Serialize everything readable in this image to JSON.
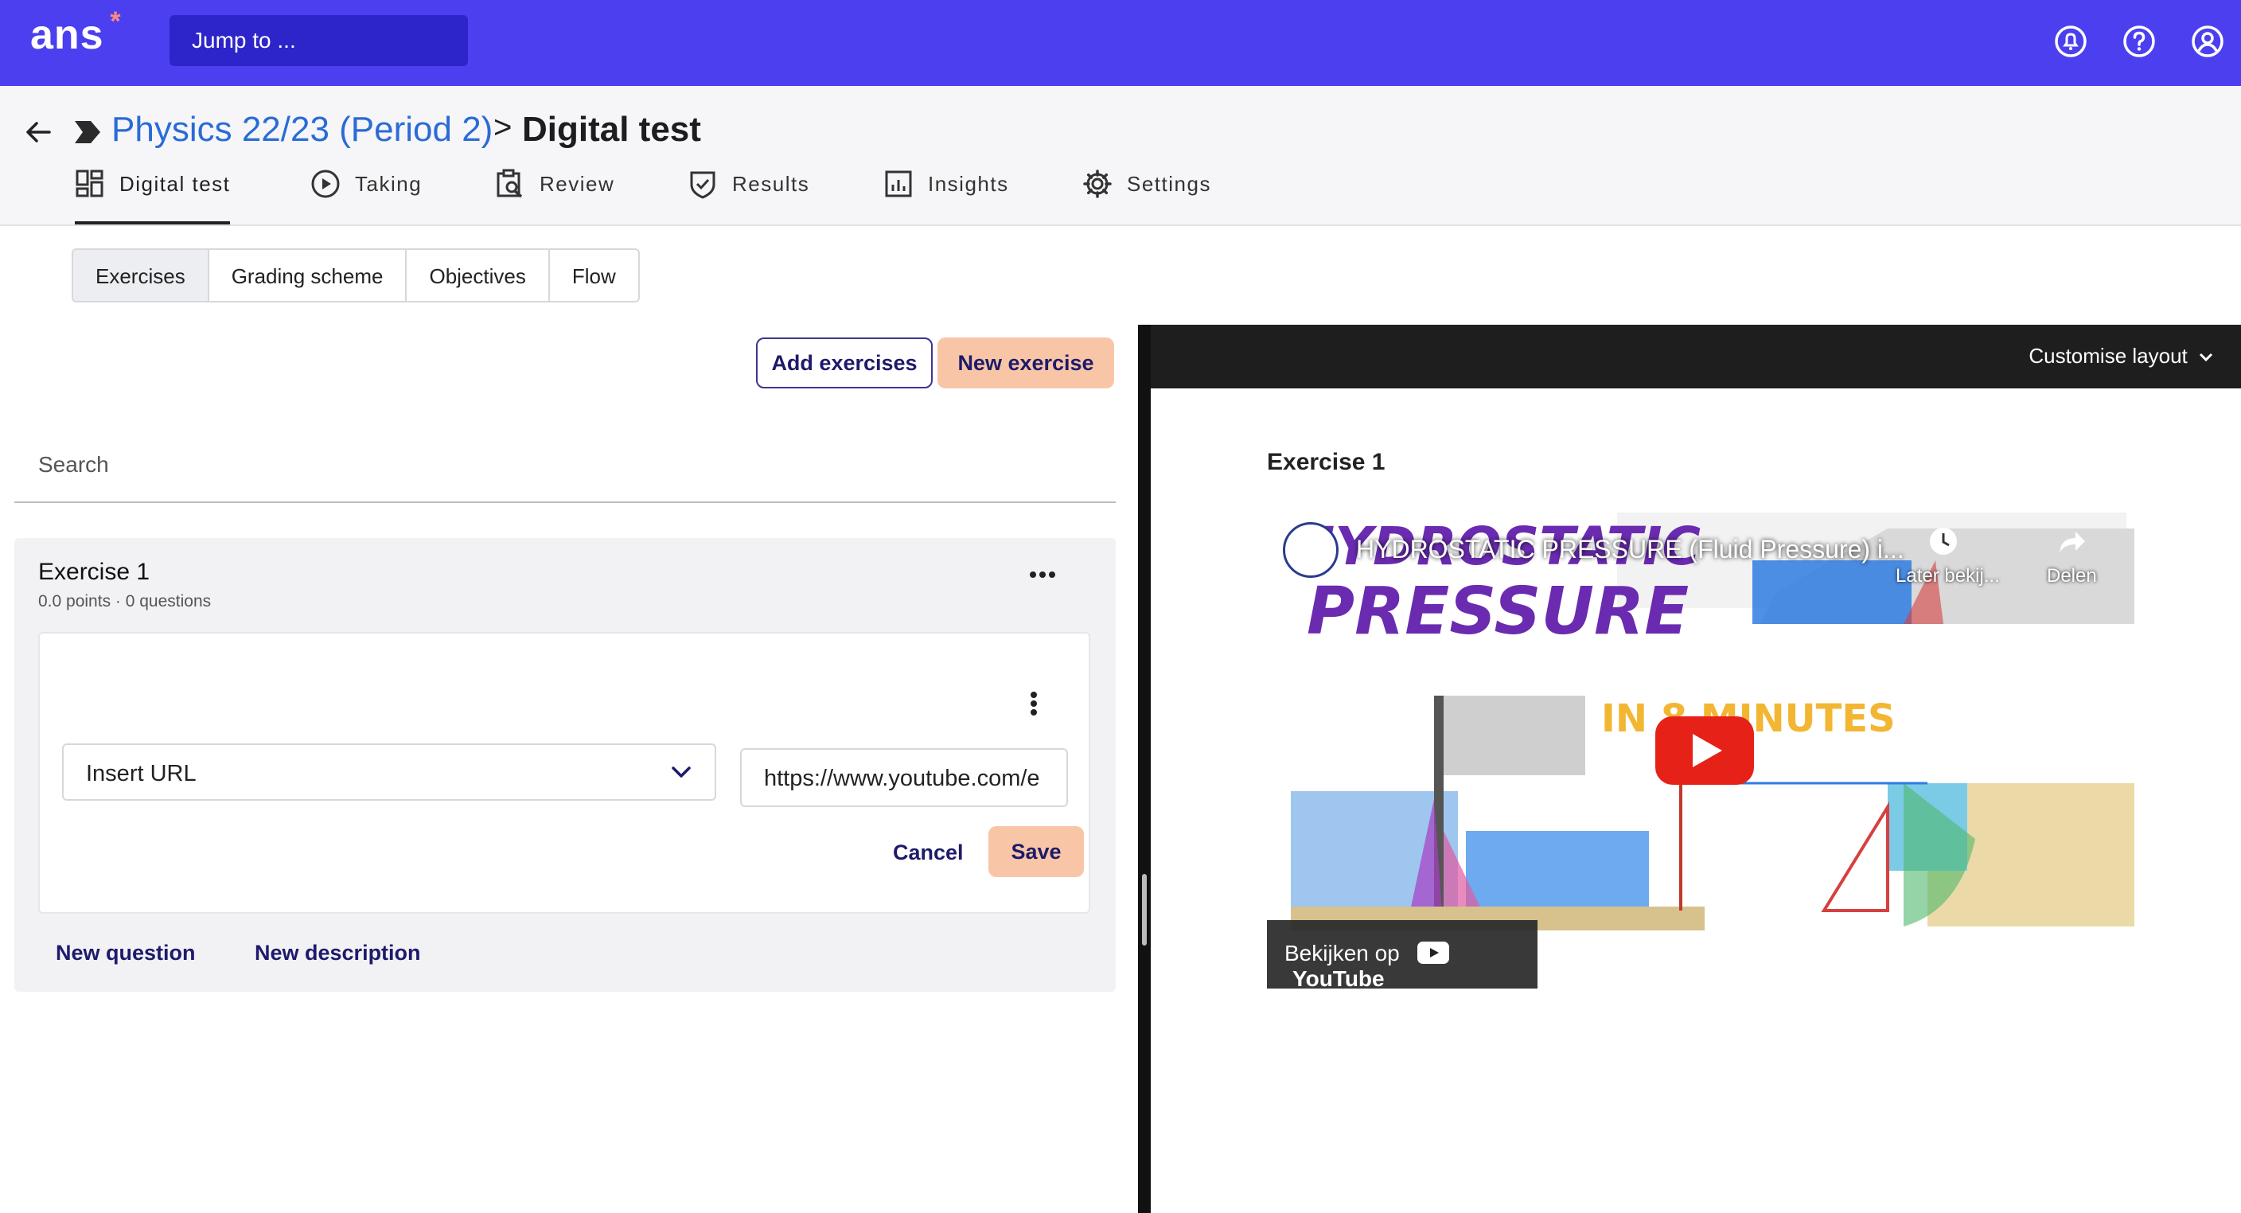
{
  "topbar": {
    "logo": "ans",
    "logo_star": "*",
    "jump_placeholder": "Jump to ...",
    "icons": [
      "notifications-icon",
      "help-icon",
      "account-icon"
    ]
  },
  "header": {
    "breadcrumb_link": "Physics 22/23 (Period 2)",
    "breadcrumb_separator": ">",
    "breadcrumb_current": "Digital test"
  },
  "tabs": [
    {
      "label": "Digital test",
      "icon": "grid-icon",
      "active": true
    },
    {
      "label": "Taking",
      "icon": "play-icon",
      "active": false
    },
    {
      "label": "Review",
      "icon": "review-icon",
      "active": false
    },
    {
      "label": "Results",
      "icon": "shield-check-icon",
      "active": false
    },
    {
      "label": "Insights",
      "icon": "chart-icon",
      "active": false
    },
    {
      "label": "Settings",
      "icon": "gear-icon",
      "active": false
    }
  ],
  "subtabs": [
    {
      "label": "Exercises",
      "active": true
    },
    {
      "label": "Grading scheme",
      "active": false
    },
    {
      "label": "Objectives",
      "active": false
    },
    {
      "label": "Flow",
      "active": false
    }
  ],
  "actions": {
    "add_exercises": "Add exercises",
    "new_exercise": "New exercise"
  },
  "search": {
    "placeholder": "Search"
  },
  "exercise": {
    "title": "Exercise 1",
    "meta": "0.0 points · 0 questions",
    "question": {
      "select_value": "Insert URL",
      "url_value": "https://www.youtube.com/e",
      "cancel": "Cancel",
      "save": "Save"
    },
    "new_question": "New question",
    "new_description": "New description"
  },
  "preview": {
    "customise_layout": "Customise layout",
    "title": "Exercise 1",
    "video": {
      "title": "HYDROSTATIC PRESSURE (Fluid Pressure) i...",
      "watch_later": "Later bekij...",
      "share": "Delen",
      "watch_on": "Bekijken op",
      "youtube": "YouTube",
      "thumb_headline_1": "HYDROSTATIC",
      "thumb_headline_2": "PRESSURE",
      "thumb_subline": "IN 8 MINUTES"
    }
  },
  "colors": {
    "topbar": "#4b3ff0",
    "accent_peach": "#f8c6a6",
    "link_blue": "#2a6bd6",
    "navy": "#1e1a6b"
  }
}
